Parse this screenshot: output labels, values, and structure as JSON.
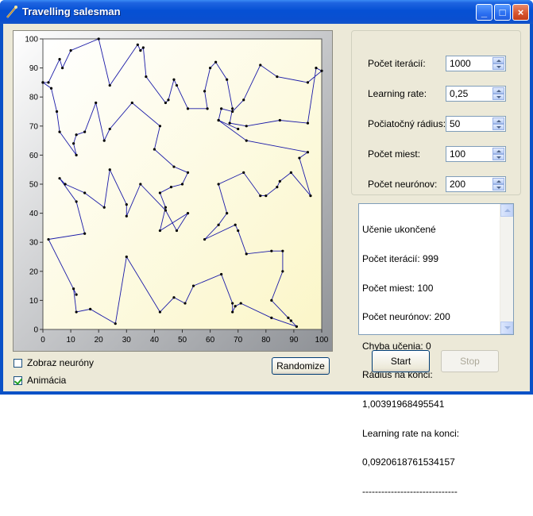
{
  "window": {
    "title": "Travelling salesman",
    "controls": {
      "minimize": "_",
      "maximize": "□",
      "close": "×"
    }
  },
  "chart_data": {
    "type": "line",
    "title": "",
    "xlabel": "",
    "ylabel": "",
    "xlim": [
      0,
      100
    ],
    "ylim": [
      0,
      100
    ],
    "xticks": [
      "0",
      "10",
      "20",
      "30",
      "40",
      "50",
      "60",
      "70",
      "80",
      "90",
      "100"
    ],
    "yticks": [
      "0",
      "10",
      "20",
      "30",
      "40",
      "50",
      "60",
      "70",
      "80",
      "90",
      "100"
    ],
    "grid": false,
    "background": "light yellow gradient",
    "series": [
      {
        "color": "#1a1aa8",
        "points": [
          [
            0,
            85
          ],
          [
            3,
            83
          ],
          [
            5,
            75
          ],
          [
            6,
            68
          ],
          [
            12,
            60
          ],
          [
            11,
            64
          ],
          [
            12,
            67
          ],
          [
            15,
            68
          ],
          [
            19,
            78
          ],
          [
            22,
            65
          ],
          [
            24,
            69
          ],
          [
            32,
            78
          ],
          [
            42,
            70
          ],
          [
            40,
            62
          ],
          [
            47,
            56
          ],
          [
            52,
            54
          ],
          [
            50,
            50
          ],
          [
            46,
            49
          ],
          [
            42,
            47
          ],
          [
            44,
            42
          ],
          [
            42,
            34
          ],
          [
            52,
            40
          ],
          [
            48,
            34
          ],
          [
            44,
            41
          ],
          [
            35,
            50
          ],
          [
            30,
            39
          ],
          [
            30,
            43
          ],
          [
            24,
            55
          ],
          [
            22,
            42
          ],
          [
            15,
            47
          ],
          [
            8,
            50
          ],
          [
            6,
            52
          ],
          [
            12,
            44
          ],
          [
            15,
            33
          ],
          [
            2,
            31
          ],
          [
            12,
            12
          ],
          [
            11,
            14
          ],
          [
            12,
            6
          ],
          [
            17,
            7
          ],
          [
            26,
            2
          ],
          [
            30,
            25
          ],
          [
            42,
            6
          ],
          [
            47,
            11
          ],
          [
            51,
            9
          ],
          [
            54,
            15
          ],
          [
            64,
            19
          ],
          [
            68,
            9
          ],
          [
            68,
            6
          ],
          [
            69,
            8
          ],
          [
            71,
            9
          ],
          [
            82,
            4
          ],
          [
            91,
            1
          ],
          [
            89,
            3
          ],
          [
            88,
            4
          ],
          [
            82,
            10
          ],
          [
            86,
            20
          ],
          [
            86,
            27
          ],
          [
            82,
            27
          ],
          [
            73,
            26
          ],
          [
            70,
            34
          ],
          [
            69,
            36
          ],
          [
            58,
            31
          ],
          [
            63,
            36
          ],
          [
            66,
            40
          ],
          [
            63,
            50
          ],
          [
            72,
            54
          ],
          [
            78,
            46
          ],
          [
            80,
            46
          ],
          [
            84,
            49
          ],
          [
            85,
            51
          ],
          [
            89,
            54
          ],
          [
            96,
            46
          ],
          [
            92,
            59
          ],
          [
            95,
            61
          ],
          [
            73,
            65
          ],
          [
            63,
            72
          ],
          [
            70,
            69
          ],
          [
            63,
            72
          ],
          [
            64,
            76
          ],
          [
            68,
            75
          ],
          [
            72,
            79
          ],
          [
            78,
            91
          ],
          [
            84,
            87
          ],
          [
            95,
            85
          ],
          [
            100,
            89
          ],
          [
            98,
            90
          ],
          [
            95,
            71
          ],
          [
            85,
            72
          ],
          [
            73,
            70
          ],
          [
            67,
            71
          ],
          [
            68,
            76
          ],
          [
            66,
            86
          ],
          [
            62,
            92
          ],
          [
            60,
            90
          ],
          [
            58,
            82
          ],
          [
            59,
            76
          ],
          [
            52,
            76
          ],
          [
            48,
            84
          ],
          [
            47,
            86
          ],
          [
            45,
            79
          ],
          [
            44,
            78
          ],
          [
            37,
            87
          ],
          [
            36,
            97
          ],
          [
            35,
            96
          ],
          [
            34,
            98
          ],
          [
            24,
            84
          ],
          [
            20,
            100
          ],
          [
            10,
            96
          ],
          [
            7,
            90
          ],
          [
            6,
            93
          ],
          [
            2,
            85
          ],
          [
            0,
            85
          ]
        ]
      }
    ]
  },
  "checkboxes": [
    {
      "label": "Zobraz neuróny",
      "checked": false
    },
    {
      "label": "Animácia",
      "checked": true
    }
  ],
  "buttons": {
    "randomize": "Randomize",
    "start": "Start",
    "stop": "Stop"
  },
  "params": [
    {
      "label": "Počet iterácií:",
      "value": "1000"
    },
    {
      "label": "Learning rate:",
      "value": "0,25"
    },
    {
      "label": "Počiatočný rádius:",
      "value": "50"
    },
    {
      "label": "Počet miest:",
      "value": "100"
    },
    {
      "label": "Počet neurónov:",
      "value": "200"
    }
  ],
  "log": {
    "lines": [
      "Učenie ukončené",
      "Počet iterácií: 999",
      "Počet miest: 100",
      "Počet neurónov: 200",
      "Chyba učenia: 0",
      "Rádius na konci:",
      "1,00391968495541",
      "Learning rate na konci:",
      "0,0920618761534157",
      "------------------------------"
    ]
  }
}
